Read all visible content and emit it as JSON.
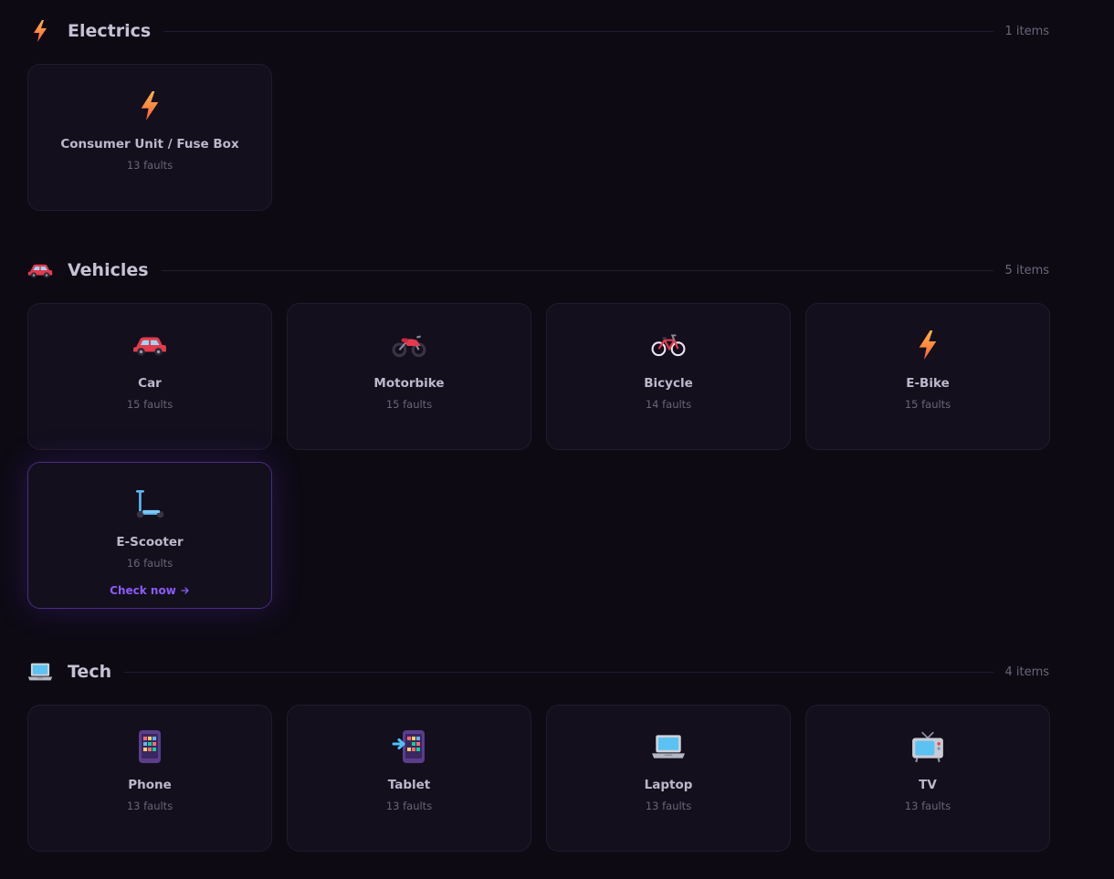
{
  "sections": [
    {
      "title": "Electrics",
      "count": "1 items",
      "icon": "lightning-icon",
      "items": [
        {
          "name": "Consumer Unit / Fuse Box",
          "faults": "13 faults",
          "icon": "lightning-icon"
        }
      ]
    },
    {
      "title": "Vehicles",
      "count": "5 items",
      "icon": "car-icon",
      "items": [
        {
          "name": "Car",
          "faults": "15 faults",
          "icon": "car-icon"
        },
        {
          "name": "Motorbike",
          "faults": "15 faults",
          "icon": "motorbike-icon"
        },
        {
          "name": "Bicycle",
          "faults": "14 faults",
          "icon": "bicycle-icon"
        },
        {
          "name": "E-Bike",
          "faults": "15 faults",
          "icon": "lightning-icon"
        },
        {
          "name": "E-Scooter",
          "faults": "16 faults",
          "icon": "scooter-icon",
          "action": "Check now"
        }
      ]
    },
    {
      "title": "Tech",
      "count": "4 items",
      "icon": "laptop-icon",
      "items": [
        {
          "name": "Phone",
          "faults": "13 faults",
          "icon": "phone-icon"
        },
        {
          "name": "Tablet",
          "faults": "13 faults",
          "icon": "tablet-icon"
        },
        {
          "name": "Laptop",
          "faults": "13 faults",
          "icon": "laptop-icon"
        },
        {
          "name": "TV",
          "faults": "13 faults",
          "icon": "tv-icon"
        }
      ]
    }
  ],
  "colors": {
    "background": "#0d0a14",
    "card": "#130f1d",
    "accent": "#8b5cf6"
  }
}
